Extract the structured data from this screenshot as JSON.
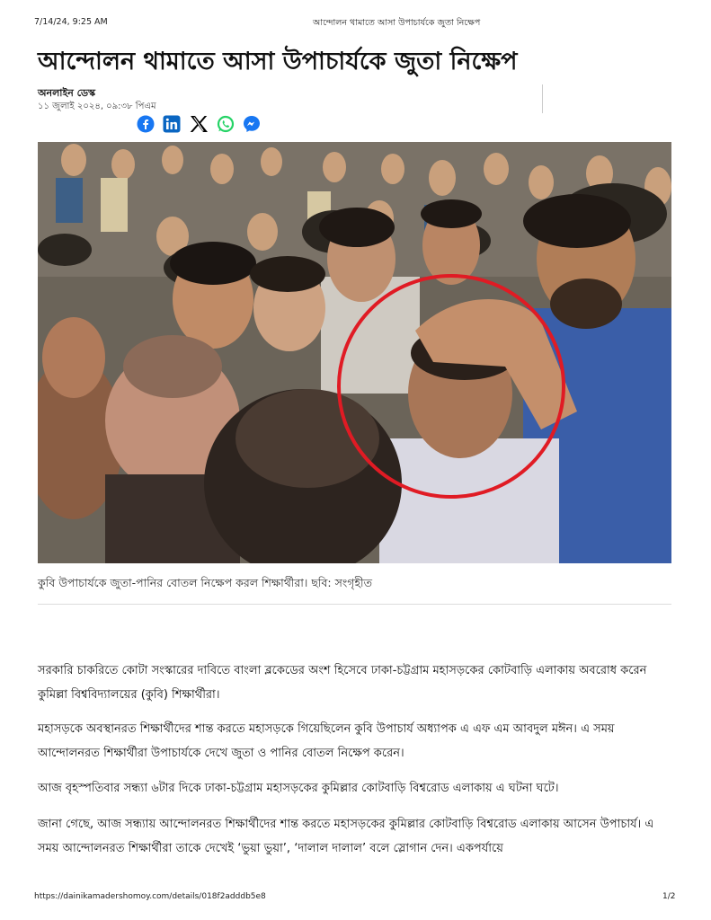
{
  "print_header": {
    "datetime": "7/14/24, 9:25 AM",
    "title": "আন্দোলন থামাতে আসা উপাচার্যকে জুতা নিক্ষেপ"
  },
  "article": {
    "headline": "আন্দোলন থামাতে আসা উপাচার্যকে জুতা নিক্ষেপ",
    "author": "অনলাইন ডেস্ক",
    "published": "১১ জুলাই ২০২৪, ০৯:৩৮ পিএম",
    "share_icons": [
      "facebook-icon",
      "linkedin-icon",
      "x-icon",
      "whatsapp-icon",
      "messenger-icon"
    ],
    "share_colors": {
      "facebook": "#1877f2",
      "linkedin": "#0a66c2",
      "x": "#000000",
      "whatsapp": "#25d366",
      "messenger": "#1877f2"
    },
    "image_caption": "কুবি উপাচার্যকে জুতা-পানির বোতল নিক্ষেপ করল শিক্ষার্থীরা। ছবি: সংগৃহীত",
    "highlight_color": "#e01b24",
    "paragraphs": [
      "সরকারি চাকরিতে কোটা সংস্কারের দাবিতে বাংলা ব্লকেডের অংশ হিসেবে ঢাকা-চট্টগ্রাম মহাসড়কের কোটবাড়ি এলাকায় অবরোধ করেন কুমিল্লা বিশ্ববিদ্যালয়ের (কুবি) শিক্ষার্থীরা।",
      "মহাসড়কে অবস্থানরত শিক্ষার্থীদের শান্ত করতে মহাসড়কে গিয়েছিলেন কুবি উপাচার্য অধ্যাপক এ এফ এম আবদুল মঈন। এ সময় আন্দোলনরত শিক্ষার্থীরা উপাচার্যকে দেখে জুতা ও পানির বোতল নিক্ষেপ করেন।",
      "আজ বৃহস্পতিবার সন্ধ্যা ৬টার দিকে ঢাকা-চট্টগ্রাম মহাসড়কের কুমিল্লার কোটবাড়ি বিশ্বরোড এলাকায় এ ঘটনা ঘটে।",
      "জানা গেছে, আজ সন্ধ্যায় আন্দোলনরত শিক্ষার্থীদের শান্ত করতে মহাসড়কের কুমিল্লার কোটবাড়ি বিশ্বরোড এলাকায় আসেন উপাচার্য। এ সময় আন্দোলনরত শিক্ষার্থীরা তাকে দেখেই ‘ভুয়া ভুয়া’, ‘দালাল দালাল’ বলে স্লোগান দেন। একপর্যায়ে"
    ]
  },
  "print_footer": {
    "url": "https://dainikamadershomoy.com/details/018f2adddb5e8",
    "page": "1/2"
  }
}
